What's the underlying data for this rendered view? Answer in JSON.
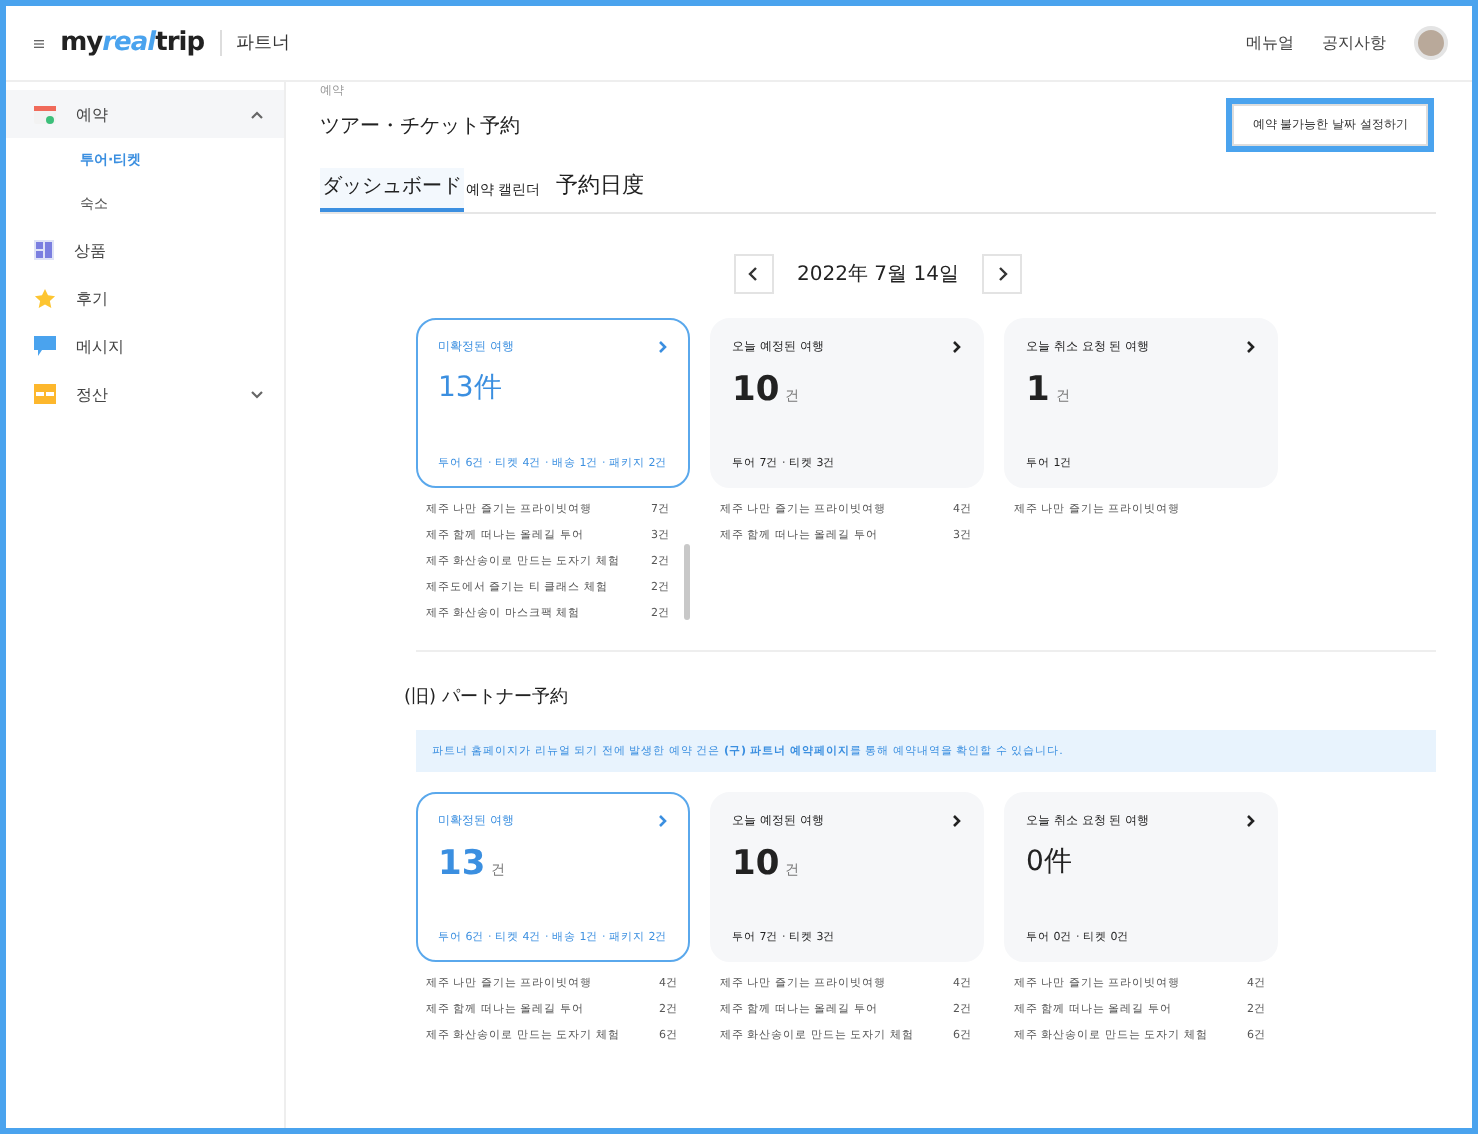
{
  "header": {
    "logo": {
      "prefix": "my",
      "highlight": "real",
      "suffix": "trip"
    },
    "partner_label": "파트너",
    "links": [
      "메뉴얼",
      "공지사항"
    ]
  },
  "sidebar": {
    "items": [
      {
        "label": "예약",
        "kind": "group",
        "expanded": true,
        "children": [
          {
            "label": "투어·티켓",
            "selected": true
          },
          {
            "label": "숙소",
            "selected": false
          }
        ]
      },
      {
        "label": "상품",
        "kind": "link"
      },
      {
        "label": "후기",
        "kind": "link"
      },
      {
        "label": "메시지",
        "kind": "link"
      },
      {
        "label": "정산",
        "kind": "group",
        "expanded": false
      }
    ]
  },
  "breadcrumb": "예약",
  "page_title": "ツアー・チケット予約",
  "action_button": "예약 불가능한 날짜 설정하기",
  "tabs": [
    {
      "label": "ダッシュボード",
      "selected": true
    },
    {
      "label": "예약 캘린더",
      "selected": false
    },
    {
      "label": "予約日度",
      "selected": false
    }
  ],
  "date_nav": {
    "date": "2022年 7월 14일"
  },
  "sections": [
    {
      "cards": [
        {
          "title": "미확정된 여행",
          "count": "13件",
          "selected": true,
          "breakdown": "투어 6건 · 티켓 4건 · 배송 1건 · 패키지 2건",
          "rows": [
            {
              "name": "제주 나만 즐기는 프라이빗여행",
              "count": "7건"
            },
            {
              "name": "제주 함께 떠나는 올레길 투어",
              "count": "3건"
            },
            {
              "name": "제주 화산송이로 만드는 도자기 체험",
              "count": "2건"
            },
            {
              "name": "제주도에서 즐기는 티 클래스 체험",
              "count": "2건"
            },
            {
              "name": "제주 화산송이 마스크팩 체험",
              "count": "2건"
            }
          ]
        },
        {
          "title": "오늘 예정된 여행",
          "count": "10",
          "unit": "건",
          "selected": false,
          "breakdown": "투어 7건 · 티켓 3건",
          "rows": [
            {
              "name": "제주 나만 즐기는 프라이빗여행",
              "count": "4건"
            },
            {
              "name": "제주 함께 떠나는 올레길 투어",
              "count": "3건"
            }
          ]
        },
        {
          "title": "오늘 취소 요청 된 여행",
          "count": "1",
          "unit": "건",
          "selected": false,
          "breakdown": "투어 1건",
          "rows": [
            {
              "name": "제주 나만 즐기는 프라이빗여행"
            }
          ]
        }
      ]
    },
    {
      "title": "(旧) パートナー予約",
      "notice": "파트너 홈페이지가 리뉴얼 되기 전에 발생한 예약 건은 **(구) 파트너 예약페이지**를 통해 예약내역을 확인할 수 있습니다.",
      "cards": [
        {
          "title": "미확정된 여행",
          "count": "13",
          "unit": "건",
          "selected": true,
          "breakdown": "투어 6건 · 티켓 4건 · 배송 1건 · 패키지 2건",
          "rows": [
            {
              "name": "제주 나만 즐기는 프라이빗여행",
              "count": "4건"
            },
            {
              "name": "제주 함께 떠나는 올레길 투어",
              "count": "2건"
            },
            {
              "name": "제주 화산송이로 만드는 도자기 체험",
              "count": "6건"
            }
          ]
        },
        {
          "title": "오늘 예정된 여행",
          "count": "10",
          "unit": "건",
          "selected": false,
          "breakdown": "투어 7건 · 티켓 3건",
          "rows": [
            {
              "name": "제주 나만 즐기는 프라이빗여행",
              "count": "4건"
            },
            {
              "name": "제주 함께 떠나는 올레길 투어",
              "count": "2건"
            },
            {
              "name": "제주 화산송이로 만드는 도자기 체험",
              "count": "6건"
            }
          ]
        },
        {
          "title": "오늘 취소 요청 된 여행",
          "count": "0件",
          "selected": false,
          "breakdown": "투어 0건 · 티켓 0건",
          "rows": [
            {
              "name": "제주 나만 즐기는 프라이빗여행",
              "count": "4건"
            },
            {
              "name": "제주 함께 떠나는 올레길 투어",
              "count": "2건"
            },
            {
              "name": "제주 화산송이로 만드는 도자기 체험",
              "count": "6건"
            }
          ]
        }
      ]
    }
  ]
}
